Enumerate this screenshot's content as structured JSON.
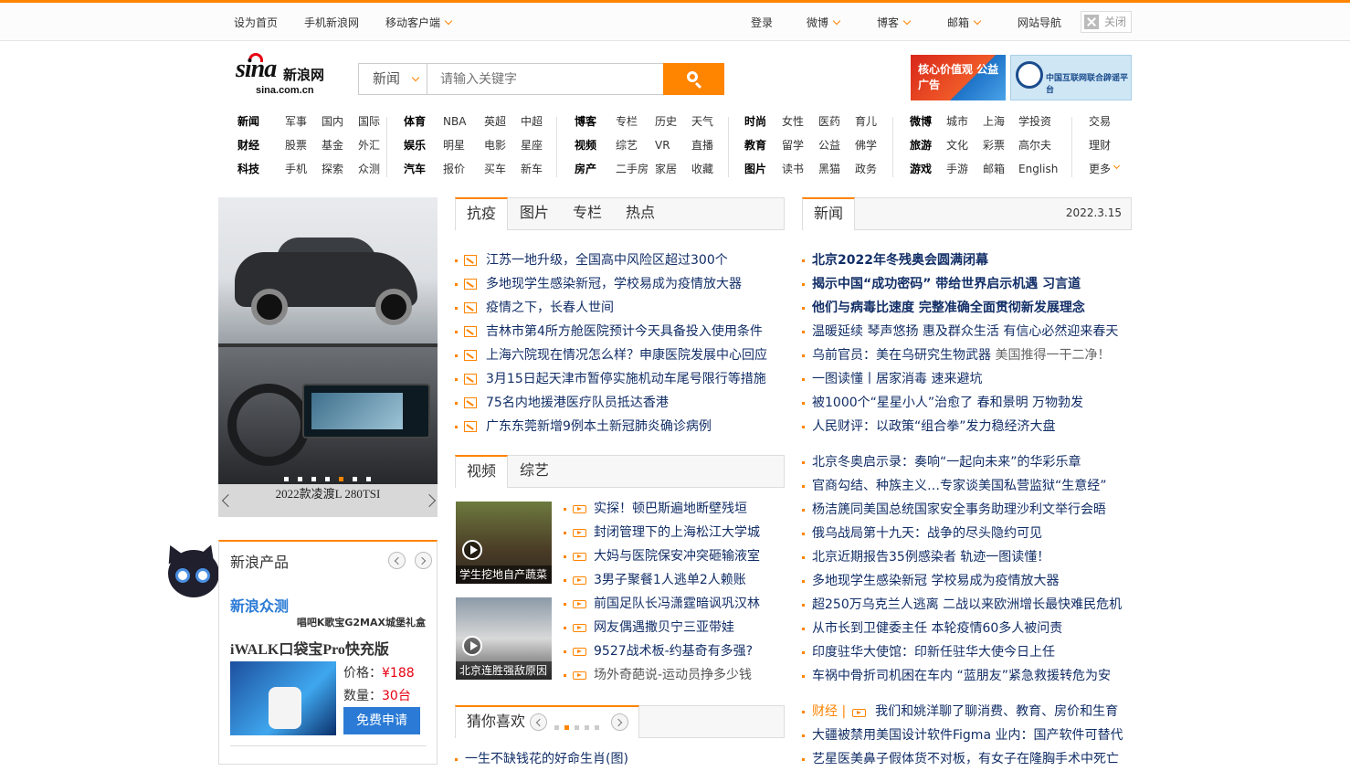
{
  "topbar": {
    "set_home": "设为首页",
    "mobile_sina": "手机新浪网",
    "mobile_client": "移动客户端",
    "login": "登录",
    "weibo": "微博",
    "blog": "博客",
    "mail": "邮箱",
    "site_nav": "网站导航",
    "close": "关闭"
  },
  "logo": {
    "text": "sina",
    "cn": "新浪网",
    "url": "sina.com.cn"
  },
  "search": {
    "category": "新闻",
    "placeholder": "请输入关键字"
  },
  "banners": {
    "b1": "核心价值观 公益广告",
    "b2": "中国互联网联合辟谣平台"
  },
  "nav": {
    "g1": [
      [
        "新闻",
        "军事",
        "国内",
        "国际"
      ],
      [
        "财经",
        "股票",
        "基金",
        "外汇"
      ],
      [
        "科技",
        "手机",
        "探索",
        "众测"
      ]
    ],
    "g2": [
      [
        "体育",
        "NBA",
        "英超",
        "中超"
      ],
      [
        "娱乐",
        "明星",
        "电影",
        "星座"
      ],
      [
        "汽车",
        "报价",
        "买车",
        "新车"
      ]
    ],
    "g3": [
      [
        "博客",
        "专栏",
        "历史",
        "天气"
      ],
      [
        "视频",
        "综艺",
        "VR",
        "直播"
      ],
      [
        "房产",
        "二手房",
        "家居",
        "收藏"
      ]
    ],
    "g4": [
      [
        "时尚",
        "女性",
        "医药",
        "育儿"
      ],
      [
        "教育",
        "留学",
        "公益",
        "佛学"
      ],
      [
        "图片",
        "读书",
        "黑猫",
        "政务"
      ]
    ],
    "g5": [
      [
        "微博",
        "城市",
        "上海",
        "学投资"
      ],
      [
        "旅游",
        "文化",
        "彩票",
        "高尔夫"
      ],
      [
        "游戏",
        "手游",
        "邮箱",
        "English"
      ]
    ],
    "g6": [
      [
        "交易"
      ],
      [
        "理财"
      ],
      [
        "更多"
      ]
    ]
  },
  "carousel": {
    "caption": "2022款凌渡L 280TSI",
    "dots": 7,
    "active_dot": 4
  },
  "tabs1": [
    "抗疫",
    "图片",
    "专栏",
    "热点"
  ],
  "list1": [
    "江苏一地升级，全国高中风险区超过300个",
    "多地现学生感染新冠，学校易成为疫情放大器",
    "疫情之下，长春人世间",
    "吉林市第4所方舱医院预计今天具备投入使用条件",
    "上海六院现在情况怎么样？申康医院发展中心回应",
    "3月15日起天津市暂停实施机动车尾号限行等措施",
    "75名内地援港医疗队员抵达香港",
    "广东东莞新增9例本土新冠肺炎确诊病例"
  ],
  "tabs2": [
    "视频",
    "综艺"
  ],
  "videos": [
    {
      "caption": "学生挖地自产蔬菜"
    },
    {
      "caption": "北京连胜强敌原因"
    }
  ],
  "list2": [
    "实探！顿巴斯遍地断壁残垣",
    "封闭管理下的上海松江大学城",
    "大妈与医院保安冲突砸输液室",
    "3男子聚餐1人逃单2人赖账",
    "前国足队长冯潇霆暗讽巩汉林",
    "网友偶遇撒贝宁三亚带娃",
    "9527战术板-约基奇有多强?",
    "场外奇葩说-运动员挣多少钱"
  ],
  "guess": {
    "title": "猜你喜欢",
    "first": "一生不缺钱花的好命生肖(图)",
    "dots": 5,
    "active_dot": 1
  },
  "news": {
    "tab": "新闻",
    "date": "2022.3.15",
    "block1": [
      "北京2022年冬残奥会圆满闭幕",
      "揭示中国“成功密码” 带给世界启示机遇 习言道",
      "他们与病毒比速度 完整准确全面贯彻新发展理念",
      "温暖延续 琴声悠扬 惠及群众生活 有信心必然迎来春天",
      "乌前官员：美在乌研究生物武器",
      "一图读懂丨居家消毒 速来避坑",
      "被1000个“星星小人”治愈了 春和景明 万物勃发",
      "人民财评：以政策“组合拳”发力稳经济大盘"
    ],
    "item5_gray": "美国推得一干二净！",
    "block2": [
      "北京冬奥启示录：奏响“一起向未来”的华彩乐章",
      "官商勾结、种族主义…专家谈美国私营监狱“生意经”",
      "杨洁篪同美国总统国家安全事务助理沙利文举行会晤",
      "俄乌战局第十九天：战争的尽头隐约可见",
      "北京近期报告35例感染者 轨迹一图读懂！",
      "多地现学生感染新冠 学校易成为疫情放大器",
      "超250万乌克兰人逃离 二战以来欧洲增长最快难民危机",
      "从市长到卫健委主任 本轮疫情60多人被问责",
      "印度驻华大使馆：印新任驻华大使今日上任",
      "车祸中骨折司机困在车内 “蓝朋友”紧急救援转危为安"
    ],
    "finance_label": "财经 |",
    "finance_item": "我们和姚洋聊了聊消费、教育、房价和生育",
    "block3": [
      "大疆被禁用美国设计软件Figma 业内：国产软件可替代",
      "艺星医美鼻子假体货不对板，有女子在隆胸手术中死亡"
    ]
  },
  "products": {
    "title": "新浪产品",
    "zhongce": "新浪众测",
    "sub": "唱吧K歌宝G2MAX城堡礼盒",
    "name": "iWALK口袋宝Pro快充版",
    "price_label": "价格：",
    "price": "¥188",
    "qty_label": "数量：",
    "qty": "30台",
    "apply": "免费申请"
  }
}
